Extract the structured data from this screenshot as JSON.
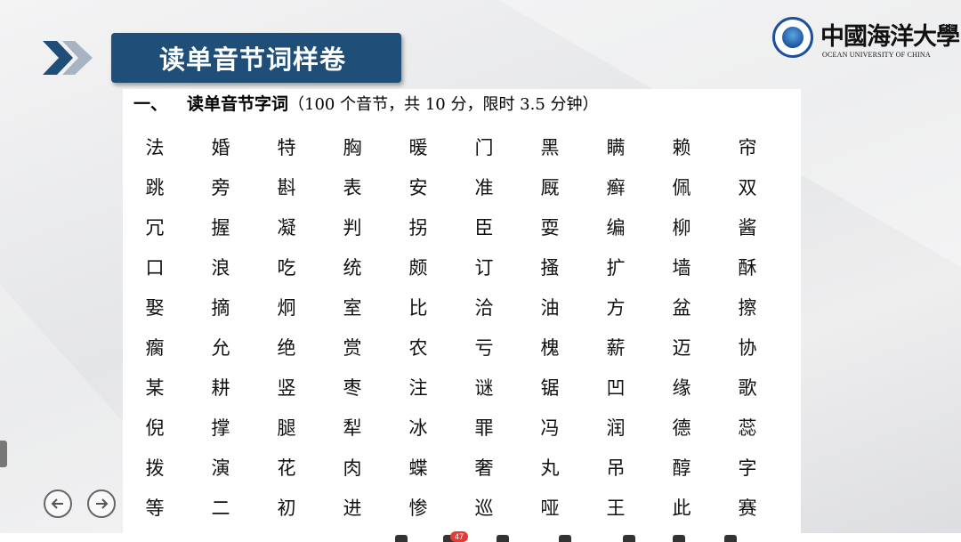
{
  "slide": {
    "title": "读单音节词样卷",
    "heading_number": "一、",
    "heading_main": "读单音节字词",
    "heading_note": "（100 个音节，共 10 分，限时 3.5 分钟）"
  },
  "logo": {
    "name_cn": "中國海洋大學",
    "name_en": "OCEAN UNIVERSITY OF CHINA"
  },
  "characters": [
    [
      "法",
      "婚",
      "特",
      "胸",
      "暖",
      "门",
      "黑",
      "瞒",
      "赖",
      "帘"
    ],
    [
      "跳",
      "旁",
      "斟",
      "表",
      "安",
      "准",
      "厩",
      "癣",
      "佩",
      "双"
    ],
    [
      "冗",
      "握",
      "凝",
      "判",
      "拐",
      "臣",
      "耍",
      "编",
      "柳",
      "酱"
    ],
    [
      "口",
      "浪",
      "吃",
      "统",
      "颇",
      "订",
      "搔",
      "扩",
      "墙",
      "酥"
    ],
    [
      "娶",
      "摘",
      "炯",
      "室",
      "比",
      "洽",
      "油",
      "方",
      "盆",
      "擦"
    ],
    [
      "瘸",
      "允",
      "绝",
      "赏",
      "农",
      "亏",
      "槐",
      "薪",
      "迈",
      "协"
    ],
    [
      "某",
      "耕",
      "竖",
      "枣",
      "注",
      "谜",
      "锯",
      "凹",
      "缘",
      "歌"
    ],
    [
      "倪",
      "撑",
      "腿",
      "犁",
      "冰",
      "罪",
      "冯",
      "润",
      "德",
      "蕊"
    ],
    [
      "拨",
      "演",
      "花",
      "肉",
      "蝶",
      "奢",
      "丸",
      "吊",
      "醇",
      "字"
    ],
    [
      "等",
      "二",
      "初",
      "进",
      "惨",
      "巡",
      "哑",
      "王",
      "此",
      "赛"
    ]
  ],
  "taskbar": {
    "badge_count": "47"
  },
  "colors": {
    "banner": "#1f4e79",
    "chevron_dark": "#1f4e79",
    "chevron_light": "#a9b4c2",
    "logo_blue": "#1c4f9c"
  }
}
